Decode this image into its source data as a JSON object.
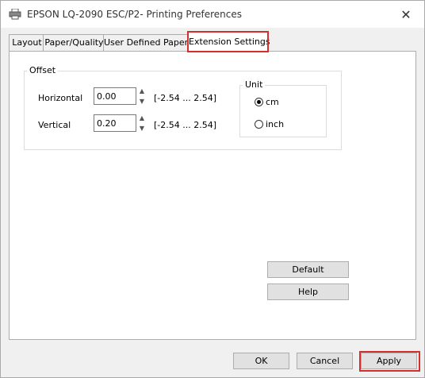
{
  "window": {
    "title": "EPSON LQ-2090 ESC/P2- Printing Preferences",
    "close_glyph": "✕"
  },
  "tabs": [
    {
      "label": "Layout",
      "active": false
    },
    {
      "label": "Paper/Quality",
      "active": false
    },
    {
      "label": "User Defined Paper",
      "active": false
    },
    {
      "label": "Extension Settings",
      "active": true
    }
  ],
  "offset": {
    "legend": "Offset",
    "horizontal": {
      "label": "Horizontal",
      "value": "0.00",
      "range": "[-2.54 ... 2.54]"
    },
    "vertical": {
      "label": "Vertical",
      "value": "0.20",
      "range": "[-2.54 ... 2.54]"
    },
    "unit": {
      "legend": "Unit",
      "options": [
        {
          "label": "cm",
          "checked": true
        },
        {
          "label": "inch",
          "checked": false
        }
      ]
    }
  },
  "buttons": {
    "default": "Default",
    "help": "Help",
    "ok": "OK",
    "cancel": "Cancel",
    "apply": "Apply"
  },
  "icons": {
    "printer": "printer-icon",
    "close": "close-icon",
    "spinner_up": "▲",
    "spinner_down": "▼"
  },
  "colors": {
    "highlight": "#d32f2f"
  }
}
